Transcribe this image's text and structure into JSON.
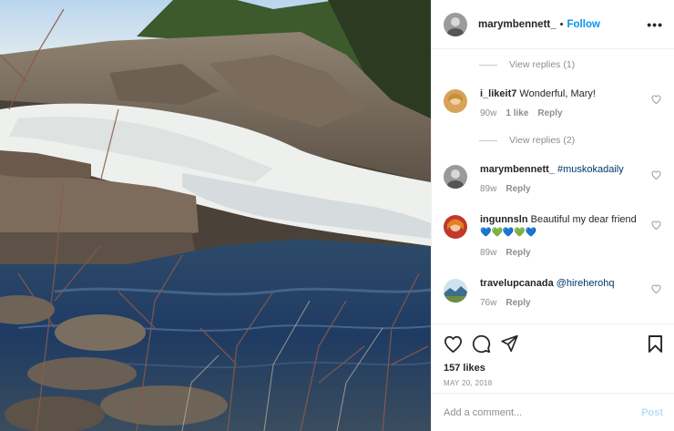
{
  "post": {
    "photo_description": "waterfall-photo",
    "author": "marymbennett_",
    "follow_label": "Follow",
    "separator": "•",
    "more_label": "•••"
  },
  "comments": [
    {
      "type": "replies",
      "label": "View replies (1)"
    },
    {
      "type": "comment",
      "user": "i_likeit7",
      "text": "Wonderful, Mary!",
      "mention": "",
      "time": "90w",
      "likes": "1 like",
      "reply": "Reply",
      "avatar_color": "#d9a25a"
    },
    {
      "type": "replies",
      "label": "View replies (2)"
    },
    {
      "type": "comment",
      "user": "marymbennett_",
      "text": "",
      "mention": "#muskokadaily",
      "time": "89w",
      "likes": "",
      "reply": "Reply",
      "avatar_color": "#777"
    },
    {
      "type": "comment",
      "user": "ingunnsln",
      "text": "Beautiful my dear friend",
      "mention": "",
      "emoji": "💙💚💙💚💙",
      "time": "89w",
      "likes": "",
      "reply": "Reply",
      "avatar_color": "#c0392b"
    },
    {
      "type": "comment",
      "user": "travelupcanada",
      "text": "",
      "mention": "@hireherohq",
      "time": "76w",
      "likes": "",
      "reply": "Reply",
      "avatar_color": "#3b6e8f"
    }
  ],
  "actions": {
    "likes": "157 likes",
    "date": "MAY 20, 2018"
  },
  "add_comment": {
    "placeholder": "Add a comment...",
    "post_label": "Post"
  },
  "colors": {
    "link": "#0095f6",
    "mention": "#00376b",
    "muted": "#8e8e8e",
    "post_disabled": "#b2dffc"
  }
}
